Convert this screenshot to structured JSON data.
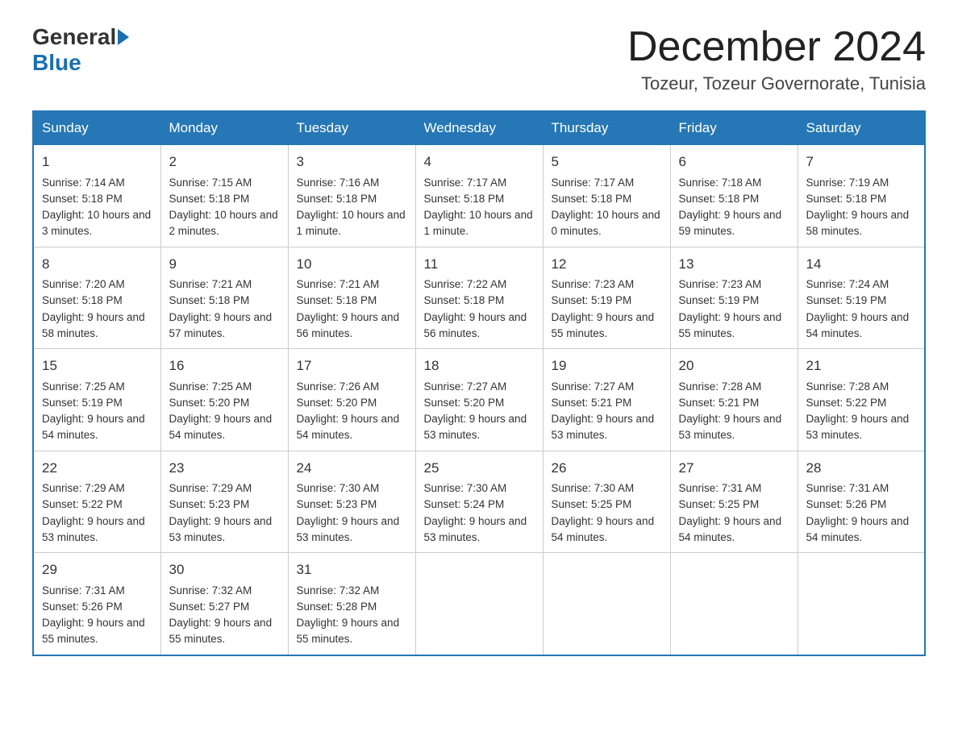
{
  "header": {
    "title": "December 2024",
    "location": "Tozeur, Tozeur Governorate, Tunisia",
    "logo_general": "General",
    "logo_blue": "Blue"
  },
  "days_of_week": [
    "Sunday",
    "Monday",
    "Tuesday",
    "Wednesday",
    "Thursday",
    "Friday",
    "Saturday"
  ],
  "weeks": [
    [
      {
        "day": "1",
        "sunrise": "7:14 AM",
        "sunset": "5:18 PM",
        "daylight": "10 hours and 3 minutes."
      },
      {
        "day": "2",
        "sunrise": "7:15 AM",
        "sunset": "5:18 PM",
        "daylight": "10 hours and 2 minutes."
      },
      {
        "day": "3",
        "sunrise": "7:16 AM",
        "sunset": "5:18 PM",
        "daylight": "10 hours and 1 minute."
      },
      {
        "day": "4",
        "sunrise": "7:17 AM",
        "sunset": "5:18 PM",
        "daylight": "10 hours and 1 minute."
      },
      {
        "day": "5",
        "sunrise": "7:17 AM",
        "sunset": "5:18 PM",
        "daylight": "10 hours and 0 minutes."
      },
      {
        "day": "6",
        "sunrise": "7:18 AM",
        "sunset": "5:18 PM",
        "daylight": "9 hours and 59 minutes."
      },
      {
        "day": "7",
        "sunrise": "7:19 AM",
        "sunset": "5:18 PM",
        "daylight": "9 hours and 58 minutes."
      }
    ],
    [
      {
        "day": "8",
        "sunrise": "7:20 AM",
        "sunset": "5:18 PM",
        "daylight": "9 hours and 58 minutes."
      },
      {
        "day": "9",
        "sunrise": "7:21 AM",
        "sunset": "5:18 PM",
        "daylight": "9 hours and 57 minutes."
      },
      {
        "day": "10",
        "sunrise": "7:21 AM",
        "sunset": "5:18 PM",
        "daylight": "9 hours and 56 minutes."
      },
      {
        "day": "11",
        "sunrise": "7:22 AM",
        "sunset": "5:18 PM",
        "daylight": "9 hours and 56 minutes."
      },
      {
        "day": "12",
        "sunrise": "7:23 AM",
        "sunset": "5:19 PM",
        "daylight": "9 hours and 55 minutes."
      },
      {
        "day": "13",
        "sunrise": "7:23 AM",
        "sunset": "5:19 PM",
        "daylight": "9 hours and 55 minutes."
      },
      {
        "day": "14",
        "sunrise": "7:24 AM",
        "sunset": "5:19 PM",
        "daylight": "9 hours and 54 minutes."
      }
    ],
    [
      {
        "day": "15",
        "sunrise": "7:25 AM",
        "sunset": "5:19 PM",
        "daylight": "9 hours and 54 minutes."
      },
      {
        "day": "16",
        "sunrise": "7:25 AM",
        "sunset": "5:20 PM",
        "daylight": "9 hours and 54 minutes."
      },
      {
        "day": "17",
        "sunrise": "7:26 AM",
        "sunset": "5:20 PM",
        "daylight": "9 hours and 54 minutes."
      },
      {
        "day": "18",
        "sunrise": "7:27 AM",
        "sunset": "5:20 PM",
        "daylight": "9 hours and 53 minutes."
      },
      {
        "day": "19",
        "sunrise": "7:27 AM",
        "sunset": "5:21 PM",
        "daylight": "9 hours and 53 minutes."
      },
      {
        "day": "20",
        "sunrise": "7:28 AM",
        "sunset": "5:21 PM",
        "daylight": "9 hours and 53 minutes."
      },
      {
        "day": "21",
        "sunrise": "7:28 AM",
        "sunset": "5:22 PM",
        "daylight": "9 hours and 53 minutes."
      }
    ],
    [
      {
        "day": "22",
        "sunrise": "7:29 AM",
        "sunset": "5:22 PM",
        "daylight": "9 hours and 53 minutes."
      },
      {
        "day": "23",
        "sunrise": "7:29 AM",
        "sunset": "5:23 PM",
        "daylight": "9 hours and 53 minutes."
      },
      {
        "day": "24",
        "sunrise": "7:30 AM",
        "sunset": "5:23 PM",
        "daylight": "9 hours and 53 minutes."
      },
      {
        "day": "25",
        "sunrise": "7:30 AM",
        "sunset": "5:24 PM",
        "daylight": "9 hours and 53 minutes."
      },
      {
        "day": "26",
        "sunrise": "7:30 AM",
        "sunset": "5:25 PM",
        "daylight": "9 hours and 54 minutes."
      },
      {
        "day": "27",
        "sunrise": "7:31 AM",
        "sunset": "5:25 PM",
        "daylight": "9 hours and 54 minutes."
      },
      {
        "day": "28",
        "sunrise": "7:31 AM",
        "sunset": "5:26 PM",
        "daylight": "9 hours and 54 minutes."
      }
    ],
    [
      {
        "day": "29",
        "sunrise": "7:31 AM",
        "sunset": "5:26 PM",
        "daylight": "9 hours and 55 minutes."
      },
      {
        "day": "30",
        "sunrise": "7:32 AM",
        "sunset": "5:27 PM",
        "daylight": "9 hours and 55 minutes."
      },
      {
        "day": "31",
        "sunrise": "7:32 AM",
        "sunset": "5:28 PM",
        "daylight": "9 hours and 55 minutes."
      },
      null,
      null,
      null,
      null
    ]
  ]
}
